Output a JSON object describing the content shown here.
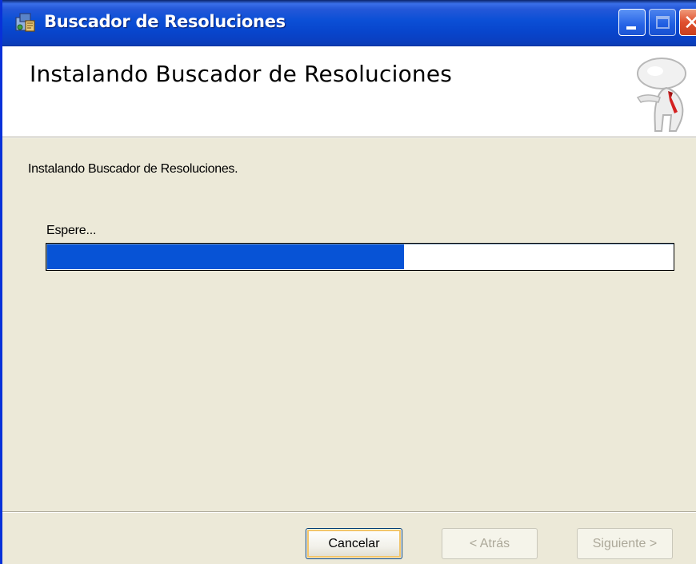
{
  "window": {
    "title": "Buscador de Resoluciones",
    "icon": "installer-package-icon",
    "controls": {
      "minimize_icon": "minimize-icon",
      "maximize_icon": "maximize-icon",
      "close_icon": "close-icon",
      "close_glyph": "✕"
    }
  },
  "banner": {
    "title": "Instalando Buscador de Resoluciones",
    "image": "mascot-figure-icon"
  },
  "main": {
    "status_text": "Instalando Buscador de Resoluciones.",
    "progress_label": "Espere...",
    "progress_fraction": 0.57
  },
  "footer": {
    "cancel_label": "Cancelar",
    "back_label": "< Atrás",
    "next_label": "Siguiente >"
  },
  "colors": {
    "title_bar": "#0b4fd6",
    "progress_fill": "#0753d6",
    "dialog_background": "#ece9d8",
    "close_button": "#e0502e"
  }
}
